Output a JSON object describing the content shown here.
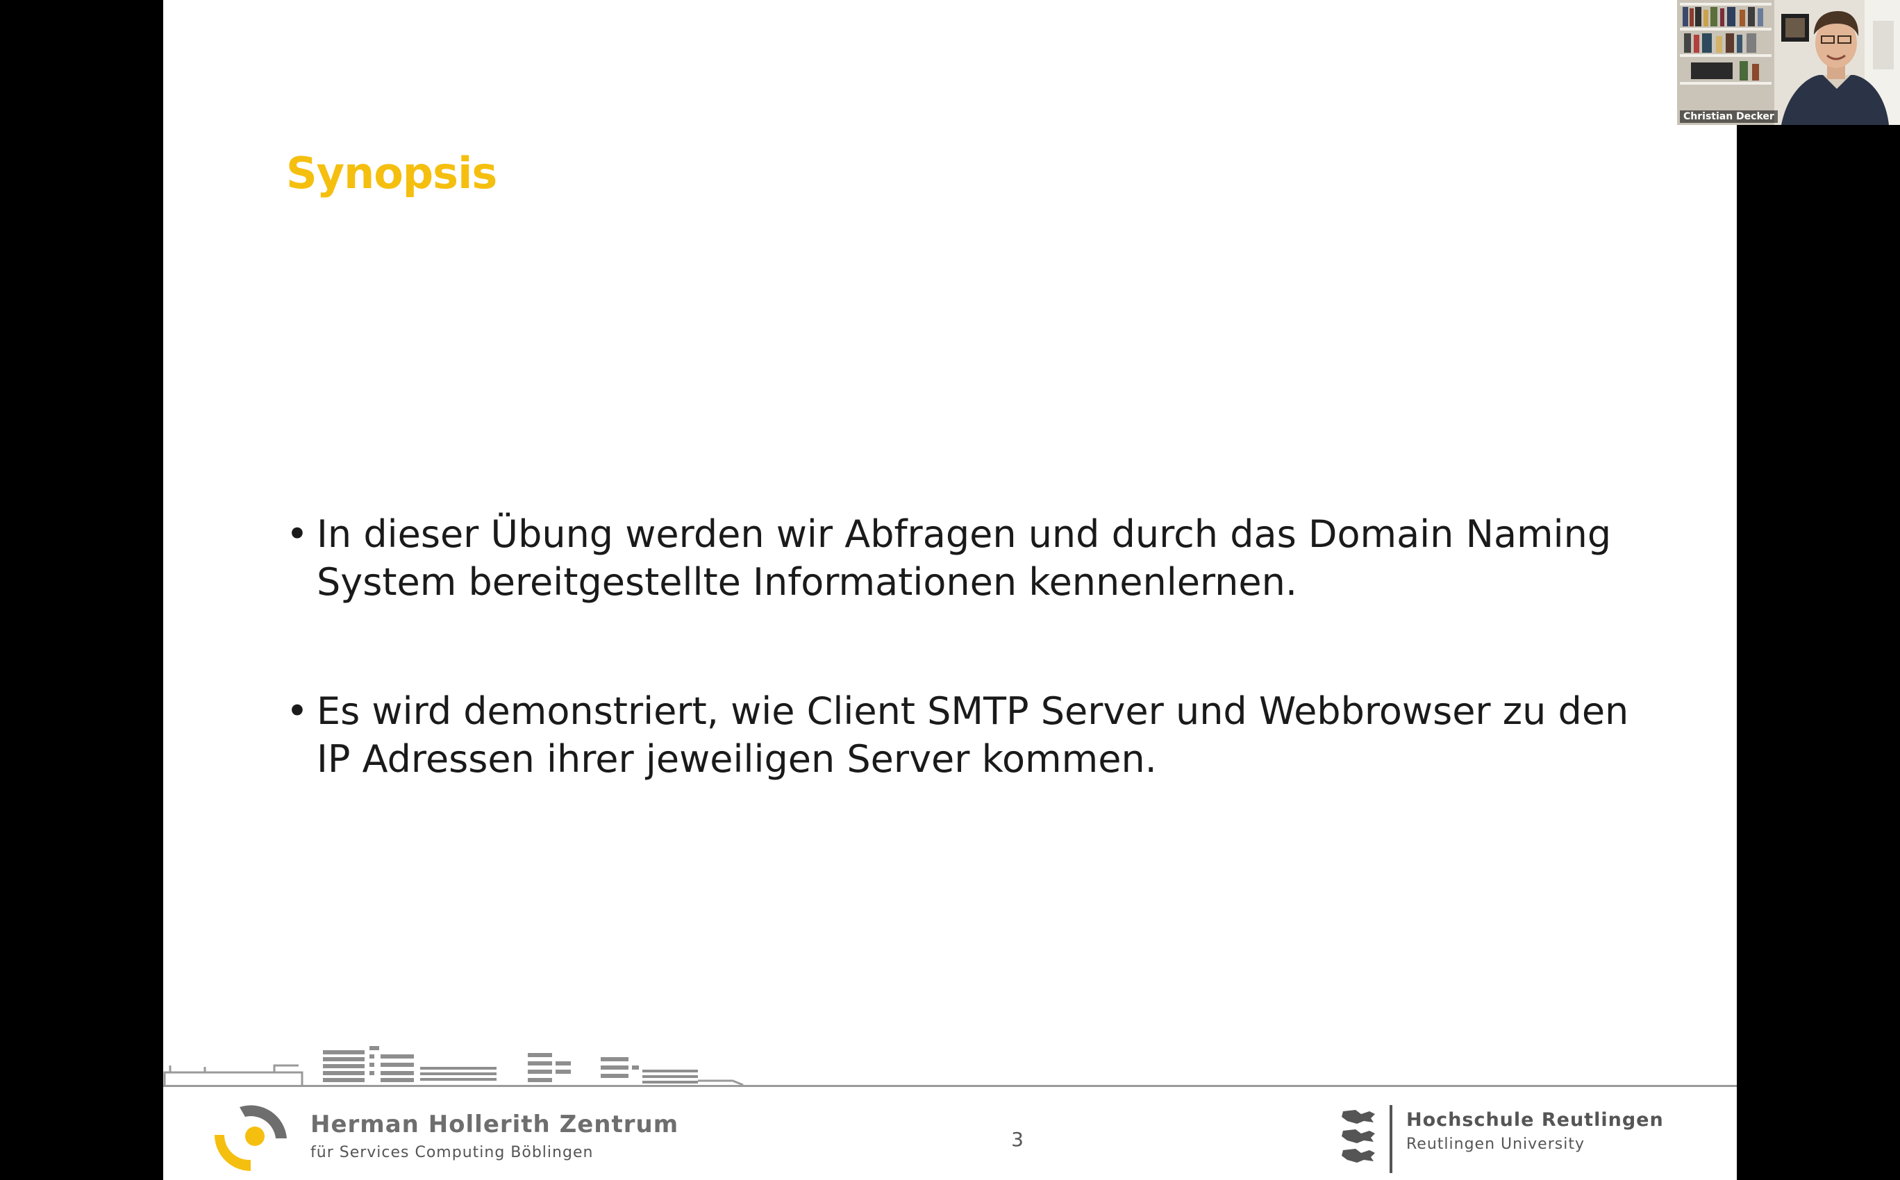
{
  "slide": {
    "title": "Synopsis",
    "bullets": [
      {
        "line1": "In dieser Übung werden wir Abfragen und durch das Domain Naming",
        "line2": "System bereitgestellte Informationen kennenlernen."
      },
      {
        "line1": "Es wird demonstriert, wie Client SMTP Server und Webbrowser zu den",
        "line2": "IP Adressen ihrer jeweiligen Server kommen."
      }
    ],
    "page_number": "3"
  },
  "footer": {
    "left_org": {
      "name": "Herman Hollerith Zentrum",
      "subtitle": "für Services Computing Böblingen",
      "logo_icon": "hhz-logo-icon"
    },
    "right_org": {
      "name": "Hochschule Reutlingen",
      "subtitle": "Reutlingen University",
      "crest_icon": "hsr-crest-icon"
    }
  },
  "video": {
    "participant_name": "Christian Decker"
  },
  "colors": {
    "title": "#f5bf0f",
    "logo_yellow": "#f5bf0f",
    "logo_gray": "#6e6e6e",
    "background": "#ffffff",
    "letterbox": "#000000"
  }
}
